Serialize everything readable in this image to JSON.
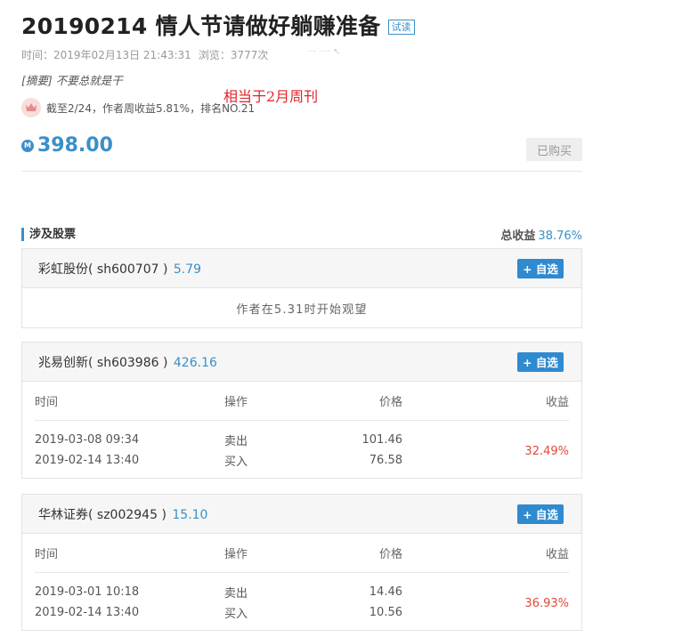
{
  "article": {
    "title": "20190214 情人节请做好躺赚准备",
    "trial_badge": "试读",
    "meta": {
      "time_label": "时间：",
      "time": "2019年02月13日 21:43:31",
      "views_label": "浏览：",
      "views": "3777次",
      "faint": "··· ···· ↖"
    },
    "summary_tag": "[摘要]",
    "summary": " 不要总就是干",
    "annotation": "相当于2月周刊",
    "rank_text": "截至2/24，作者周收益5.81%，排名NO.21",
    "price": "398.00",
    "coin_symbol": "M",
    "bought_label": "已购买"
  },
  "stocks_section": {
    "title": "涉及股票",
    "total_label": "总收益",
    "total_value": "38.76%",
    "add_label": "+ 自选",
    "columns": [
      "时间",
      "操作",
      "价格",
      "收益"
    ],
    "stocks": [
      {
        "name": "彩虹股份",
        "code": "( sh600707 )",
        "price": "5.79",
        "note": "作者在5.31时开始观望"
      },
      {
        "name": "兆易创新",
        "code": "( sh603986 )",
        "price": "426.16",
        "trades": [
          {
            "time": "2019-03-08 09:34",
            "op": "卖出",
            "price": "101.46"
          },
          {
            "time": "2019-02-14 13:40",
            "op": "买入",
            "price": "76.58"
          }
        ],
        "profit": "32.49%"
      },
      {
        "name": "华林证券",
        "code": "( sz002945 )",
        "price": "15.10",
        "trades": [
          {
            "time": "2019-03-01 10:18",
            "op": "卖出",
            "price": "14.46"
          },
          {
            "time": "2019-02-14 13:40",
            "op": "买入",
            "price": "10.56"
          }
        ],
        "profit": "36.93%"
      }
    ]
  }
}
